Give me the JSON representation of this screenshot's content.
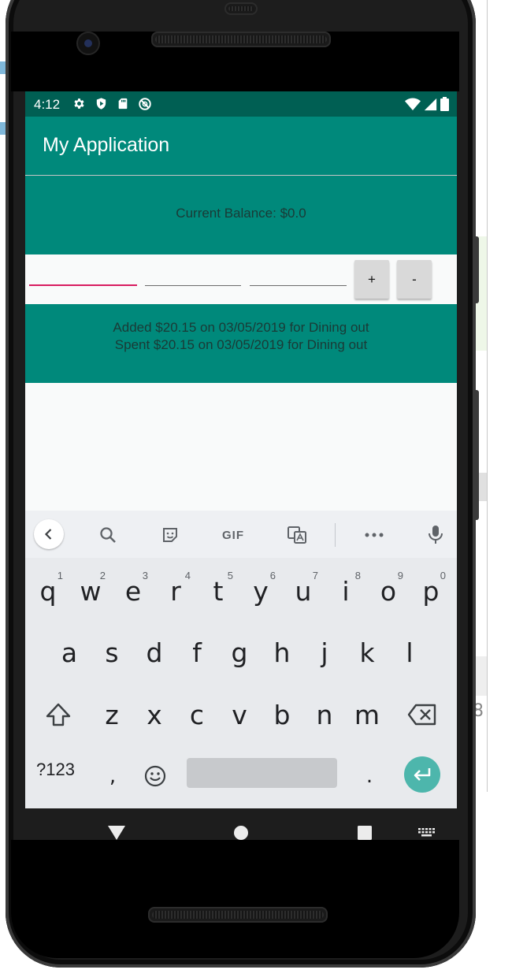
{
  "status_bar": {
    "time": "4:12",
    "left_icons": [
      "gear-icon",
      "shield-play-icon",
      "sd-card-icon",
      "no-sync-icon"
    ],
    "right_icons": [
      "wifi-icon",
      "cell-signal-icon",
      "battery-icon"
    ]
  },
  "app": {
    "title": "My Application",
    "balance": "Current Balance: $0.0",
    "fields": [
      {
        "name": "amount",
        "value": "",
        "placeholder": ""
      },
      {
        "name": "date",
        "value": "",
        "placeholder": ""
      },
      {
        "name": "category",
        "value": "",
        "placeholder": ""
      }
    ],
    "add_button": "+",
    "subtract_button": "-",
    "history": [
      "Added $20.15 on 03/05/2019 for Dining out",
      "Spent $20.15 on 03/05/2019 for Dining out"
    ]
  },
  "keyboard": {
    "toolbar": {
      "gif_label": "GIF",
      "icons": [
        "chevron-left-icon",
        "search-icon",
        "sticker-icon",
        "gif-icon",
        "translate-icon",
        "more-icon",
        "mic-icon"
      ]
    },
    "row1": [
      {
        "key": "q",
        "hint": "1"
      },
      {
        "key": "w",
        "hint": "2"
      },
      {
        "key": "e",
        "hint": "3"
      },
      {
        "key": "r",
        "hint": "4"
      },
      {
        "key": "t",
        "hint": "5"
      },
      {
        "key": "y",
        "hint": "6"
      },
      {
        "key": "u",
        "hint": "7"
      },
      {
        "key": "i",
        "hint": "8"
      },
      {
        "key": "o",
        "hint": "9"
      },
      {
        "key": "p",
        "hint": "0"
      }
    ],
    "row2": [
      "a",
      "s",
      "d",
      "f",
      "g",
      "h",
      "j",
      "k",
      "l"
    ],
    "row3": [
      "z",
      "x",
      "c",
      "v",
      "b",
      "n",
      "m"
    ],
    "row4": {
      "symbols": "?123",
      "comma": ",",
      "period": "."
    }
  },
  "nav_bar": {
    "icons": [
      "back-triangle-icon",
      "home-circle-icon",
      "recents-square-icon",
      "keyboard-switch-icon"
    ]
  },
  "colors": {
    "primary": "#00897b",
    "primary_dark": "#005f53",
    "accent": "#d81b60",
    "enter_key": "#4db6ac"
  },
  "background": {
    "right_edge_digit": "8"
  }
}
